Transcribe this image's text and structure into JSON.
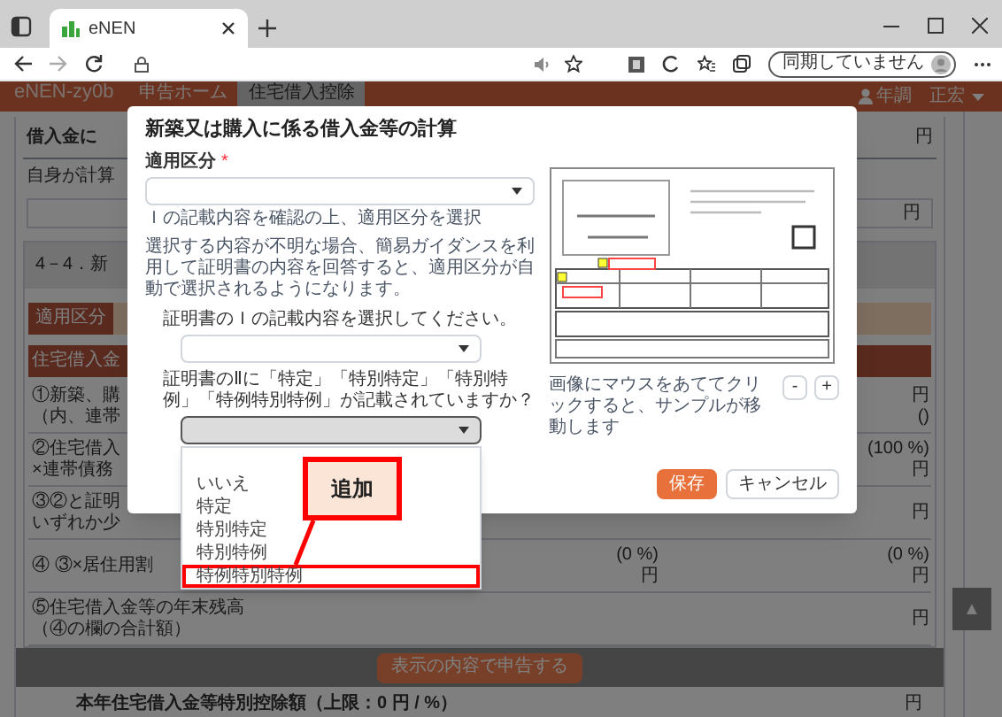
{
  "browser": {
    "tab": {
      "title": "eNEN"
    },
    "profile_button": "同期していません"
  },
  "nav": {
    "brand": "eNEN-zy0b",
    "items": [
      {
        "label": "申告ホーム",
        "selected": false
      },
      {
        "label": "住宅借入控除",
        "selected": true
      }
    ],
    "user_role": "年調",
    "user_name": "正宏"
  },
  "page": {
    "section_header": {
      "label": "借入金に",
      "unit": "円"
    },
    "self_calc": {
      "label": "自身が計算",
      "unit": "円"
    },
    "card_title": "4－4．新",
    "category_label": "適用区分",
    "table_header": "住宅借入金",
    "rows": [
      {
        "label_lines": [
          "①新築、購",
          "（内、連帯"
        ],
        "middle": [],
        "right": [
          "円",
          "()"
        ]
      },
      {
        "label_lines": [
          "②住宅借入",
          "×連帯債務"
        ],
        "middle": [],
        "right": [
          "(100 %)",
          "円"
        ]
      },
      {
        "label_lines": [
          "③②と証明",
          "いずれか少"
        ],
        "middle": [],
        "right": [
          "円"
        ]
      },
      {
        "label_lines": [
          "④ ③×居住用割"
        ],
        "middle": [
          "(0 %)",
          "円"
        ],
        "right": [
          "(0 %)",
          "円"
        ]
      },
      {
        "label_lines": [
          "⑤住宅借入金等の年末残高",
          "（④の欄の合計額）"
        ],
        "middle": [],
        "right": [
          "円"
        ]
      }
    ],
    "submit_button": "表示の内容で申告する",
    "total": {
      "label": "本年住宅借入金等特別控除額（上限：0 円 / %）",
      "unit": "円"
    },
    "back_to_top": "▲"
  },
  "modal": {
    "title": "新築又は購入に係る借入金等の計算",
    "category_field": {
      "label": "適用区分",
      "required_mark": "*",
      "hint": "Ｉの記載内容を確認の上、適用区分を選択"
    },
    "guidance": "選択する内容が不明な場合、簡易ガイダンスを利用して証明書の内容を回答すると、適用区分が自動で選択されるようになります。",
    "question_1": {
      "label": "証明書のＩの記載内容を選択してください。"
    },
    "question_2": {
      "label": "証明書のⅡに「特定」「特別特定」「特別特例」「特例特別特例」が記載されていますか？",
      "expanded": true,
      "options": [
        {
          "label": "いいえ",
          "annotated": false
        },
        {
          "label": "特定",
          "annotated": false
        },
        {
          "label": "特別特定",
          "annotated": false
        },
        {
          "label": "特別特例",
          "annotated": false
        },
        {
          "label": "特例特別特例",
          "annotated": true
        }
      ]
    },
    "callout": "追加",
    "sample": {
      "kind": "picture",
      "caption": "画像にマウスをあててクリックすると、サンプルが移動します",
      "zoom_buttons": [
        "-",
        "+"
      ]
    },
    "buttons": [
      {
        "label": "保存",
        "kind": "primary"
      },
      {
        "label": "キャンセル",
        "kind": "secondary"
      }
    ]
  }
}
